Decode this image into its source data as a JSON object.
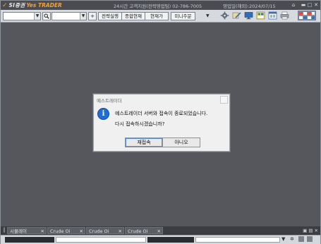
{
  "titlebar": {
    "logo_mark": "✓",
    "logo_brand": "SI증권",
    "logo_product": "Yes TRADER",
    "hotline": "24시간 고객지원(전략영업팀) 02-786-7005",
    "business_day": "영업일(해외):2024/07/15"
  },
  "toolbar": {
    "buttons": [
      "전략실행",
      "종합현재",
      "현재가",
      "미니주문"
    ],
    "plus_label": "+",
    "dropdown_label": "▼"
  },
  "dialog": {
    "title": "예스트레이더",
    "line1": "예스트레이더 서버와 접속이 종료되었습니다.",
    "line2": "다시 접속하시겠습니까?",
    "confirm_label": "재접속",
    "cancel_label": "아니오"
  },
  "tabs": [
    {
      "label": "시뮬레이"
    },
    {
      "label": "Crude Oi"
    },
    {
      "label": "Crude Oi"
    },
    {
      "label": "Crude Oi"
    }
  ],
  "colors": {
    "workspace": "#55575c",
    "accent": "#f2a23a",
    "info_icon": "#1f6ed4"
  }
}
